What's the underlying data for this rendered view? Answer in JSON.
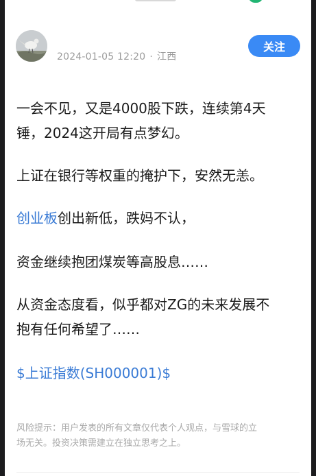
{
  "post": {
    "timestamp": "2024-01-05 12:20",
    "separator": "·",
    "location": "江西",
    "follow_label": "关注"
  },
  "content": {
    "p1_line1": "一会不见，又是4000股下跌，连续第4天",
    "p1_line2": "锤，2024这开局有点梦幻。",
    "p2": "上证在银行等权重的掩护下，安然无恙。",
    "p3_link": "创业板",
    "p3_rest": "创出新低，跌妈不认，",
    "p4": "资金继续抱团煤炭等高股息……",
    "p5_line1": "从资金态度看，似乎都对ZG的未来发展不",
    "p5_line2": "抱有任何希望了……",
    "stock_link": "$上证指数(SH000001)$"
  },
  "risk": {
    "line1": "风险提示：用户发表的所有文章仅代表个人观点，与雪球的立",
    "line2": "场无关。投资决策需建立在独立思考之上。"
  },
  "colors": {
    "accent": "#3a8af5",
    "link": "#3a7bd5",
    "muted": "#9b9b9b"
  }
}
